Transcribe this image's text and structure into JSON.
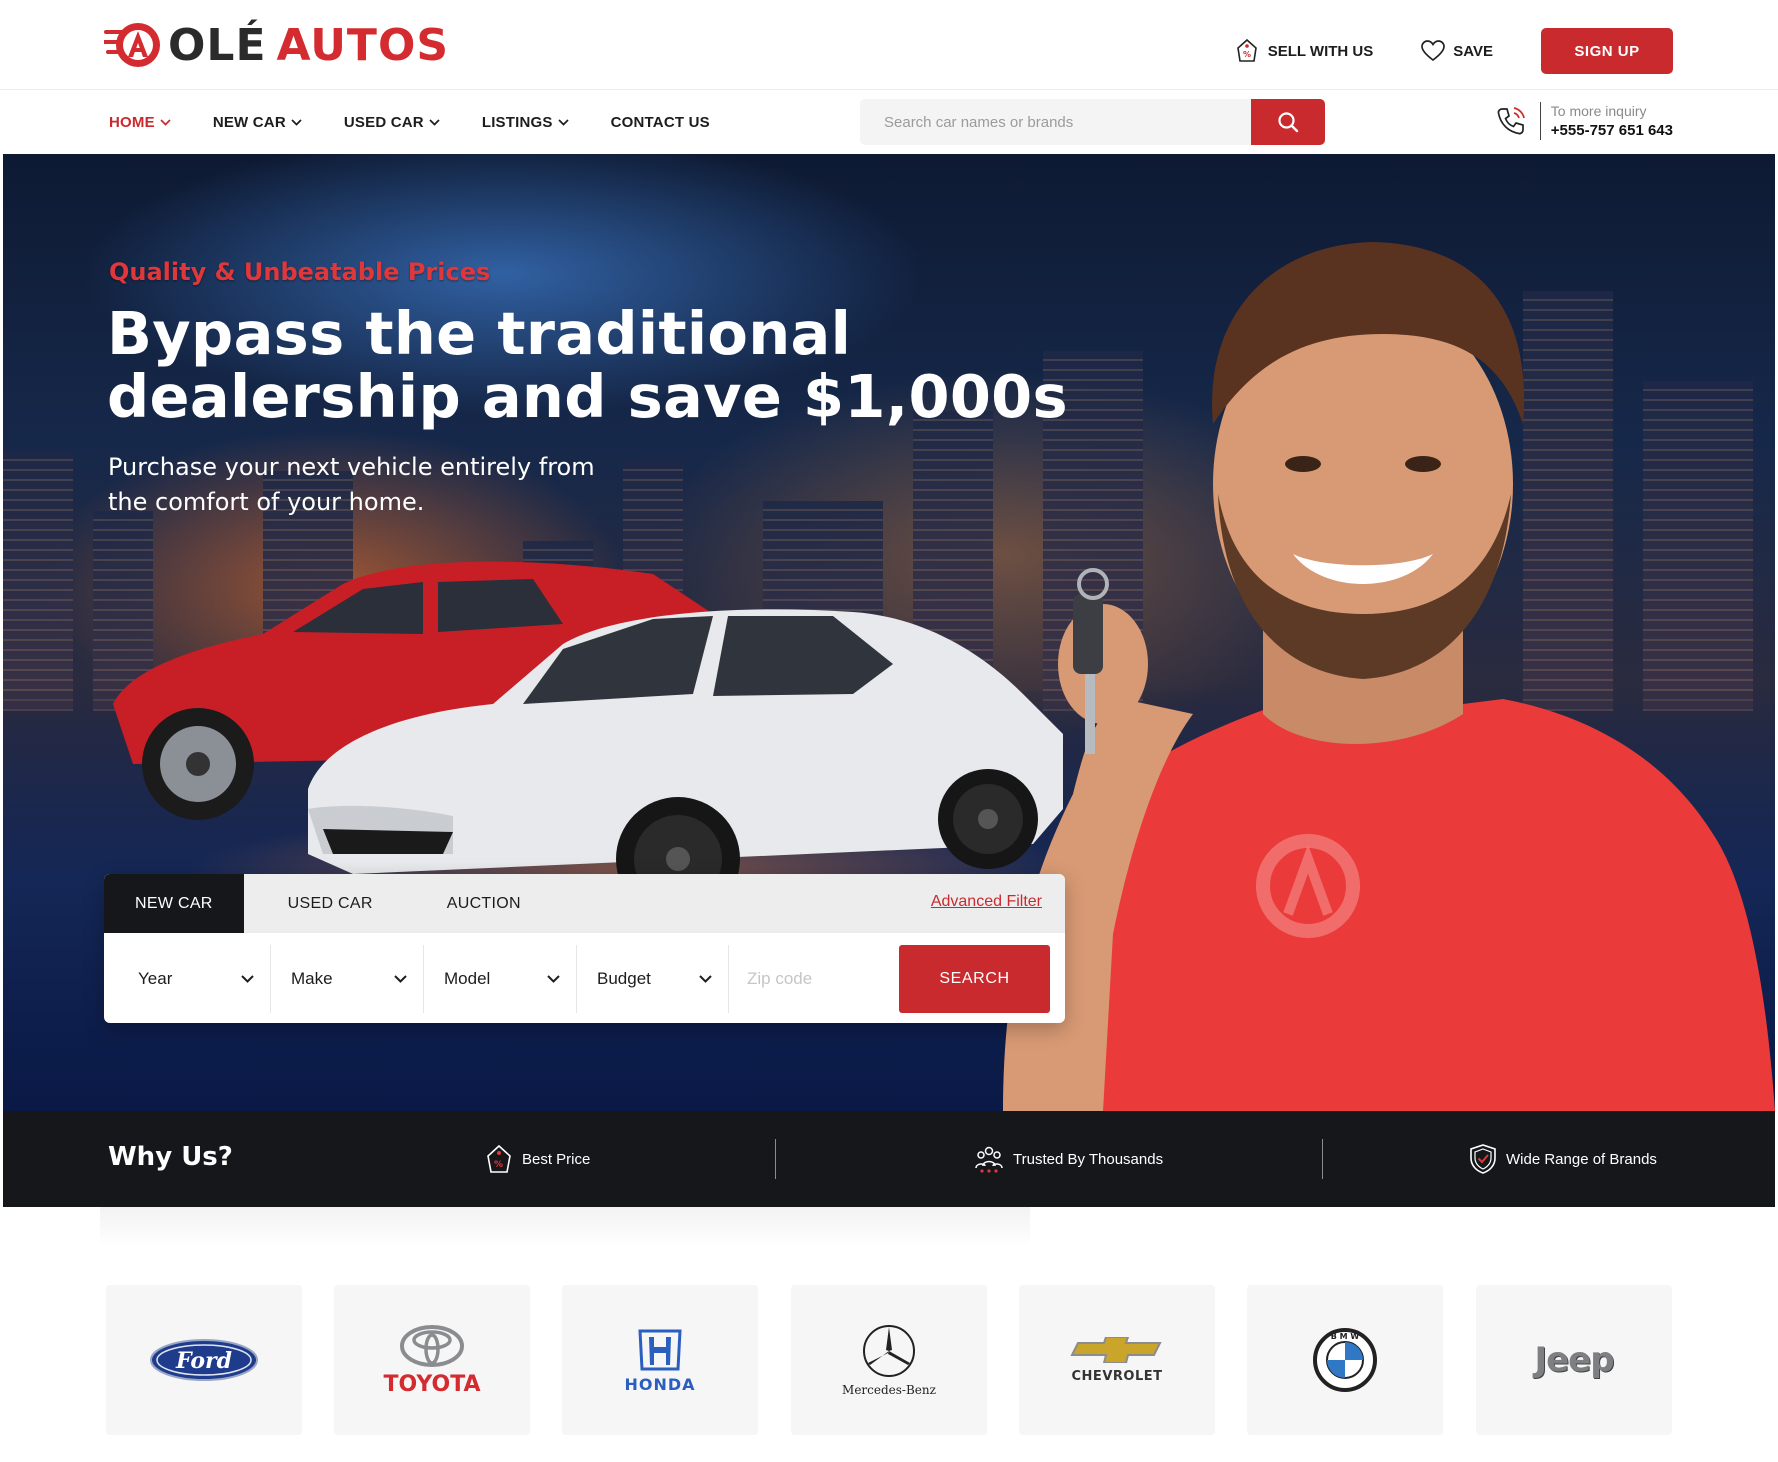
{
  "brand": {
    "ole": "OLÉ",
    "autos": "AUTOS"
  },
  "top": {
    "sell": "SELL WITH US",
    "save": "SAVE",
    "signup": "SIGN UP"
  },
  "nav": {
    "items": [
      {
        "label": "HOME",
        "active": true,
        "dropdown": true
      },
      {
        "label": "NEW CAR",
        "active": false,
        "dropdown": true
      },
      {
        "label": "USED CAR",
        "active": false,
        "dropdown": true
      },
      {
        "label": "LISTINGS",
        "active": false,
        "dropdown": true
      },
      {
        "label": "CONTACT US",
        "active": false,
        "dropdown": false
      }
    ],
    "search_placeholder": "Search car names or brands",
    "inquiry_label": "To more inquiry",
    "inquiry_phone": "+555-757 651 643"
  },
  "hero": {
    "eyebrow": "Quality & Unbeatable Prices",
    "title_line1": "Bypass the traditional",
    "title_line2": "dealership and save $1,000s",
    "sub_line1": "Purchase your next vehicle entirely from",
    "sub_line2": "the comfort of your home."
  },
  "filter": {
    "tabs": [
      "NEW CAR",
      "USED CAR",
      "AUCTION"
    ],
    "active_tab": "NEW CAR",
    "advanced": "Advanced Filter",
    "selects": [
      "Year",
      "Make",
      "Model",
      "Budget"
    ],
    "zip_placeholder": "Zip code",
    "search": "SEARCH"
  },
  "why": {
    "title": "Why Us?",
    "items": [
      "Best Price",
      "Trusted By Thousands",
      "Wide Range of Brands"
    ]
  },
  "brands": {
    "ford": "Ford",
    "toyota": "TOYOTA",
    "honda": "HONDA",
    "mercedes": "Mercedes-Benz",
    "chevrolet": "CHEVROLET",
    "bmw": "B M W",
    "jeep": "Jeep"
  },
  "colors": {
    "accent": "#c92a2e",
    "dark": "#16171b"
  }
}
